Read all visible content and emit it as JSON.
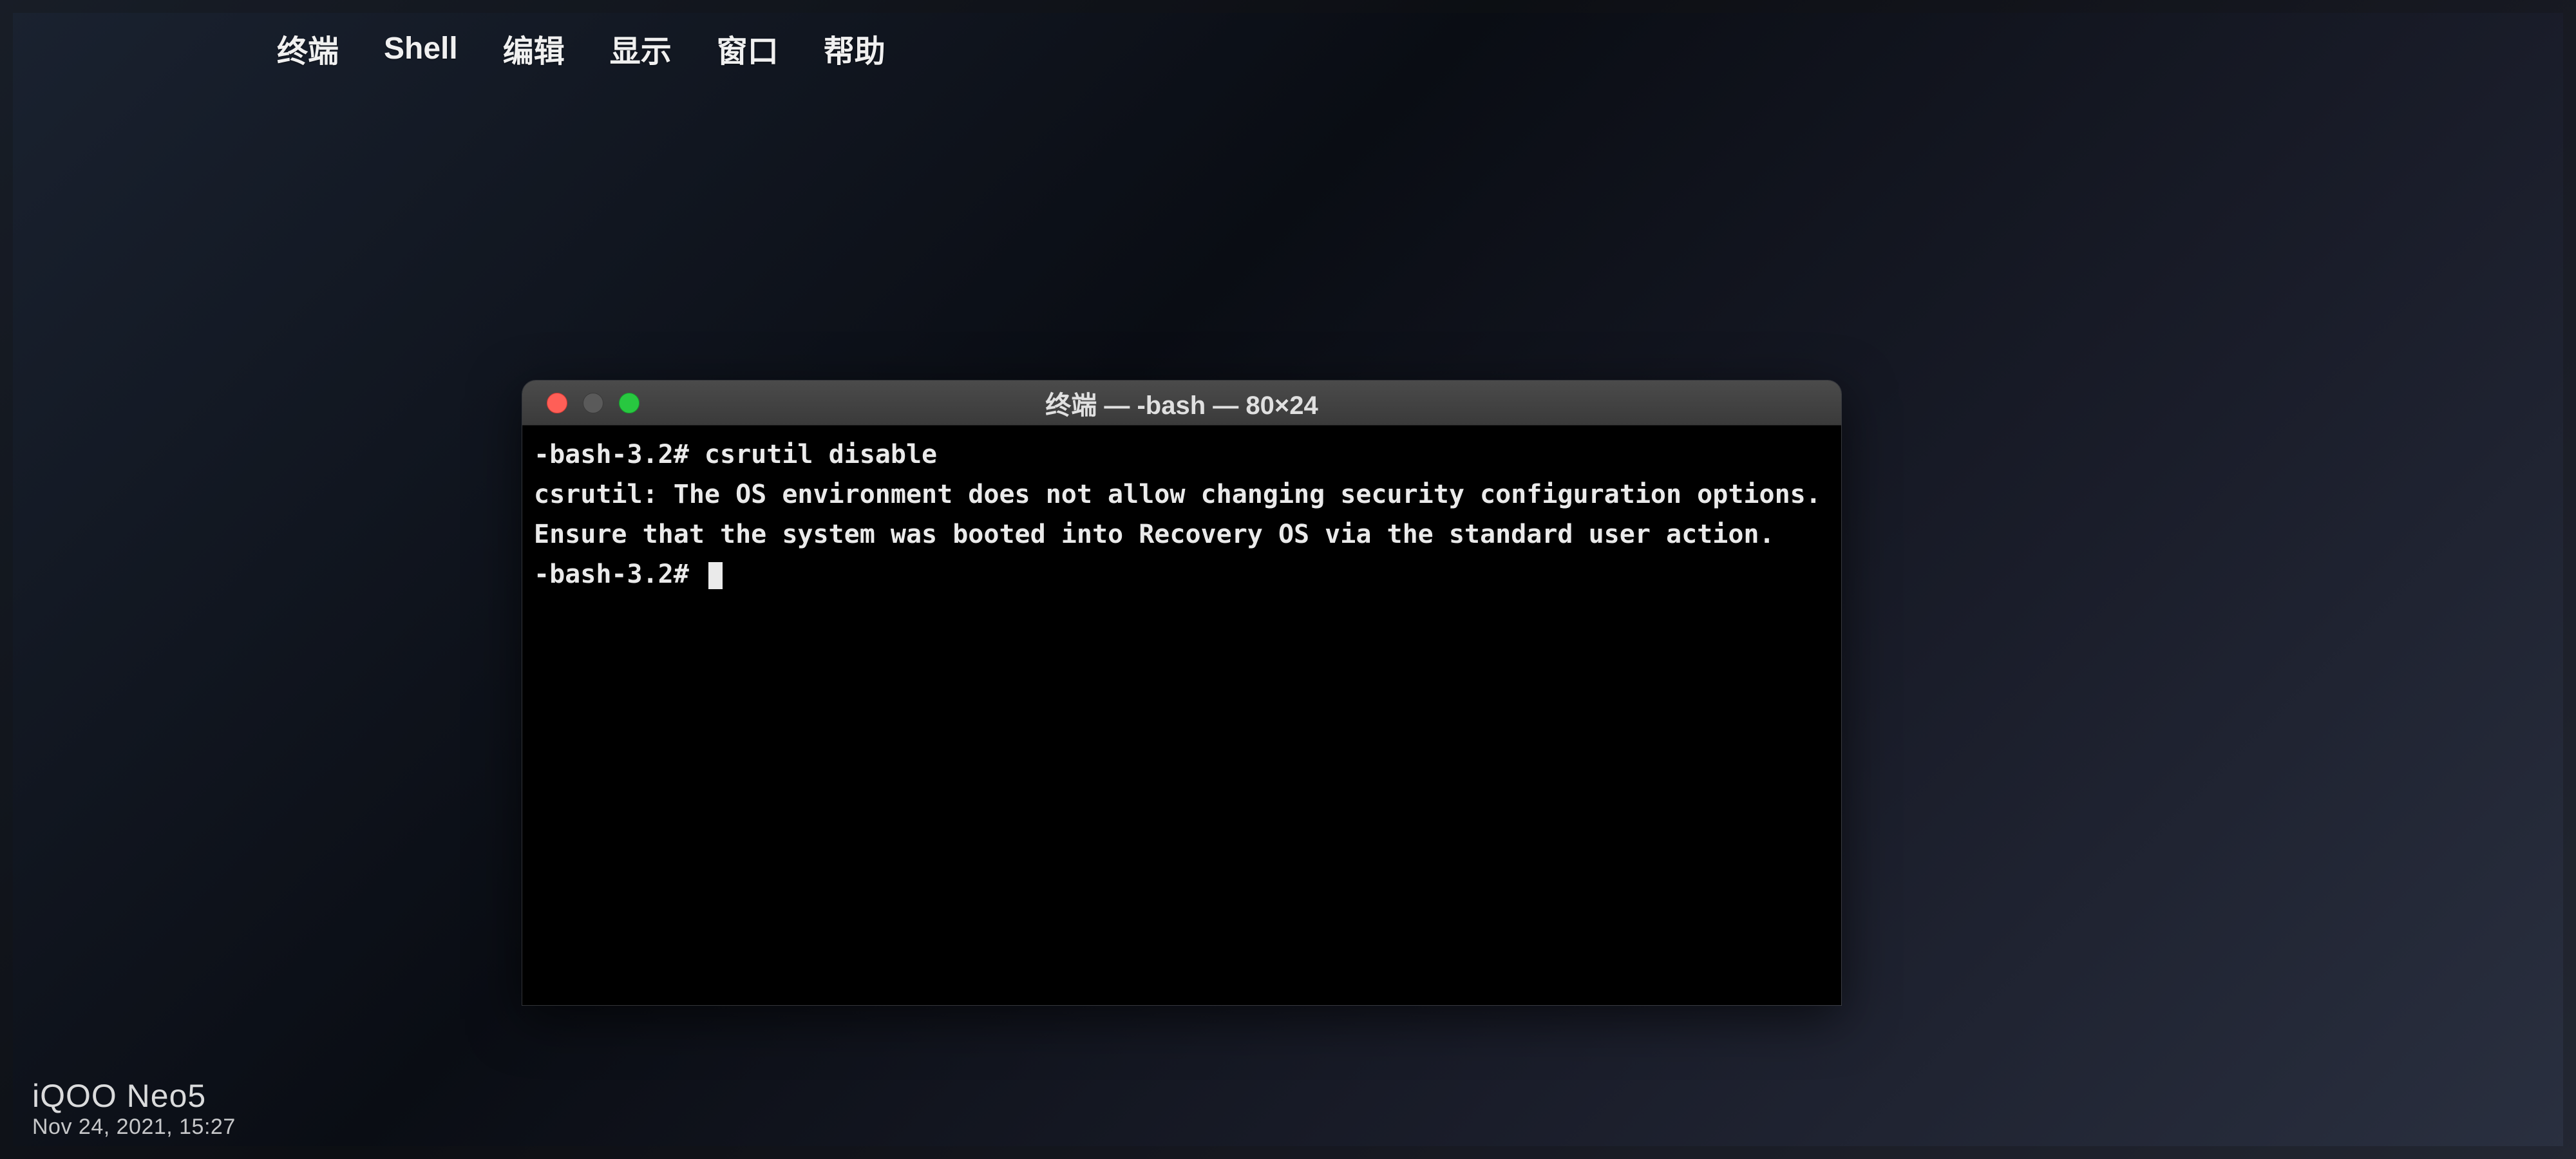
{
  "menubar": {
    "apple": "",
    "items": [
      "终端",
      "Shell",
      "编辑",
      "显示",
      "窗口",
      "帮助"
    ]
  },
  "window": {
    "title": "终端 — -bash — 80×24"
  },
  "terminal": {
    "prompt1": "-bash-3.2# ",
    "command": "csrutil disable",
    "output_line1": "csrutil: The OS environment does not allow changing security configuration options.",
    "output_line2": "Ensure that the system was booted into Recovery OS via the standard user action.",
    "prompt2": "-bash-3.2# "
  },
  "watermark": {
    "brand": "iQOO Neo5",
    "stamp": "Nov 24, 2021, 15:27"
  }
}
